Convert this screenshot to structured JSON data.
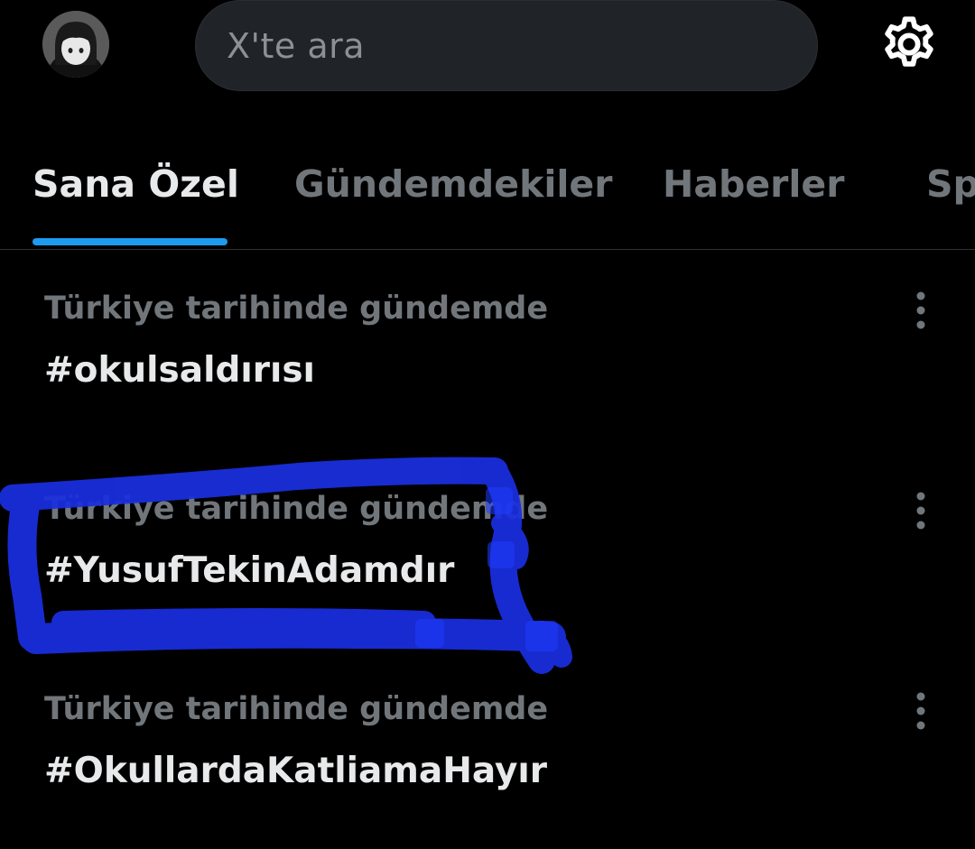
{
  "search": {
    "placeholder": "X'te ara"
  },
  "icons": {
    "avatar": "user-avatar",
    "settings": "gear-icon",
    "more": "more-vertical-icon"
  },
  "tabs": [
    {
      "label": "Sana Özel",
      "active": true
    },
    {
      "label": "Gündemdekiler",
      "active": false
    },
    {
      "label": "Haberler",
      "active": false
    },
    {
      "label": "Sp",
      "active": false
    }
  ],
  "trends": [
    {
      "context": "Türkiye tarihinde gündemde",
      "tag": "#okulsaldırısı"
    },
    {
      "context": "Türkiye tarihinde gündemde",
      "tag": "#YusufTekinAdamdır"
    },
    {
      "context": "Türkiye tarihinde gündemde",
      "tag": "#OkullardaKatliamaHayır"
    }
  ],
  "colors": {
    "background": "#000000",
    "accent": "#1d9bf0",
    "text_primary": "#e7e9ea",
    "text_secondary": "#71767b",
    "highlight_scribble": "#1a2fe0"
  }
}
